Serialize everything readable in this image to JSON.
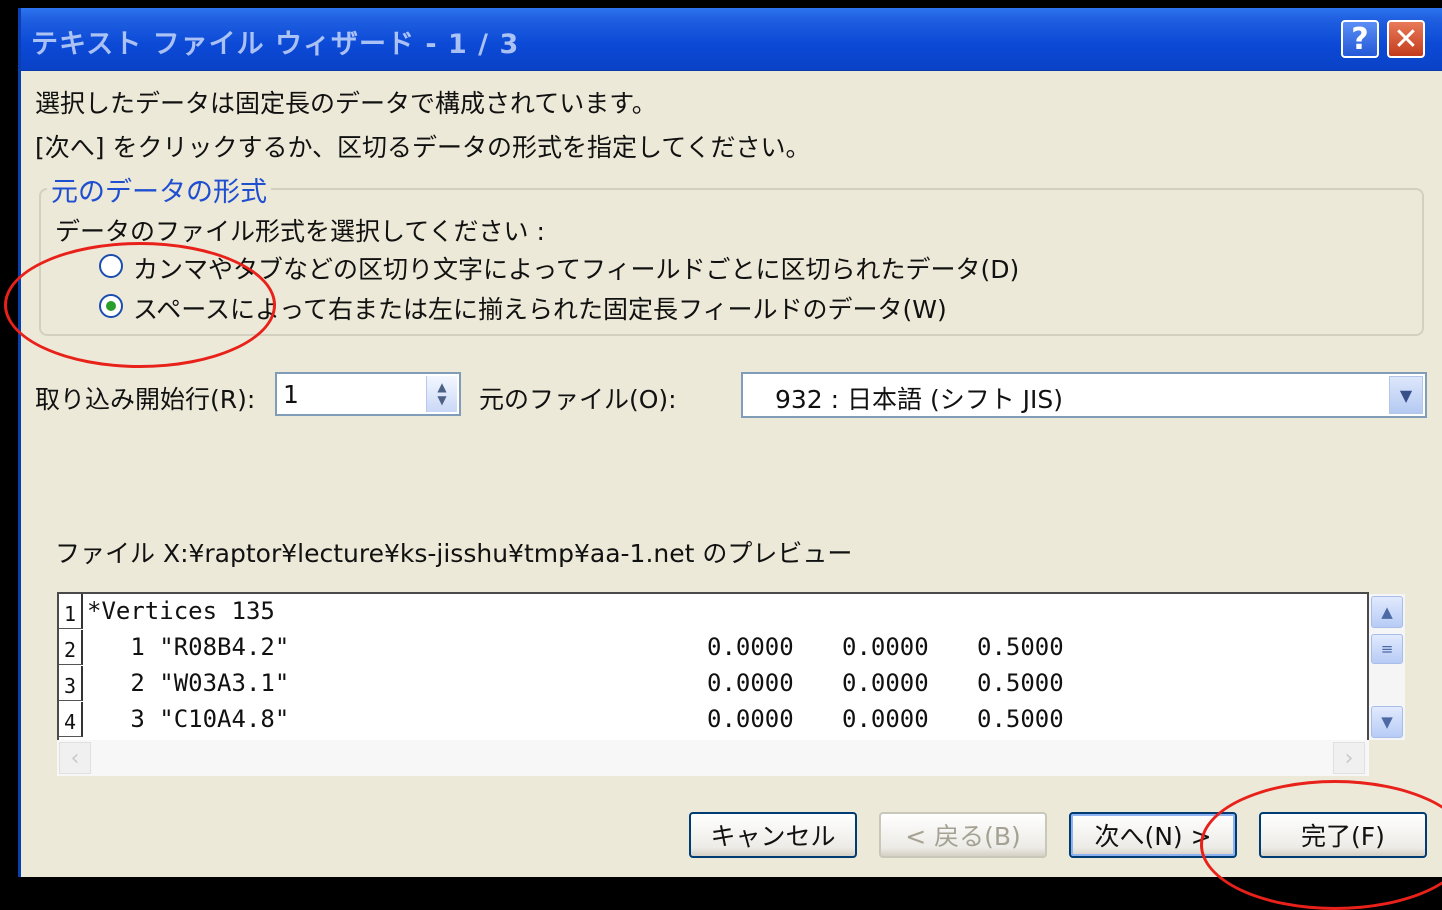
{
  "window": {
    "title": "テキスト ファイル ウィザード - 1 / 3",
    "help_label": "?",
    "close_label": "✕"
  },
  "intro": {
    "line1": "選択したデータは固定長のデータで構成されています。",
    "line2": "[次へ] をクリックするか、区切るデータの形式を指定してください。"
  },
  "source_format": {
    "legend": "元のデータの形式",
    "prompt": "データのファイル形式を選択してください :",
    "options": [
      {
        "label": "カンマやタブなどの区切り文字によってフィールドごとに区切られたデータ(D)",
        "checked": false
      },
      {
        "label": "スペースによって右または左に揃えられた固定長フィールドのデータ(W)",
        "checked": true
      }
    ]
  },
  "start_row": {
    "label": "取り込み開始行(R):",
    "value": "1"
  },
  "file_origin": {
    "label": "元のファイル(O):",
    "value": "932 : 日本語 (シフト JIS)"
  },
  "preview": {
    "caption": "ファイル X:¥raptor¥lecture¥ks-jisshu¥tmp¥aa-1.net のプレビュー",
    "rows": [
      {
        "num": "1",
        "text": "*Vertices 135",
        "c1": "",
        "c2": "",
        "c3": ""
      },
      {
        "num": "2",
        "text": "   1 \"R08B4.2\"",
        "c1": "0.0000",
        "c2": "0.0000",
        "c3": "0.5000"
      },
      {
        "num": "3",
        "text": "   2 \"W03A3.1\"",
        "c1": "0.0000",
        "c2": "0.0000",
        "c3": "0.5000"
      },
      {
        "num": "4",
        "text": "   3 \"C10A4.8\"",
        "c1": "0.0000",
        "c2": "0.0000",
        "c3": "0.5000"
      }
    ]
  },
  "buttons": {
    "cancel": "キャンセル",
    "back": "< 戻る(B)",
    "next": "次へ(N) >",
    "finish": "完了(F)"
  },
  "colors": {
    "annotation": "#e8211a",
    "titlebar": "#0b49d6"
  }
}
